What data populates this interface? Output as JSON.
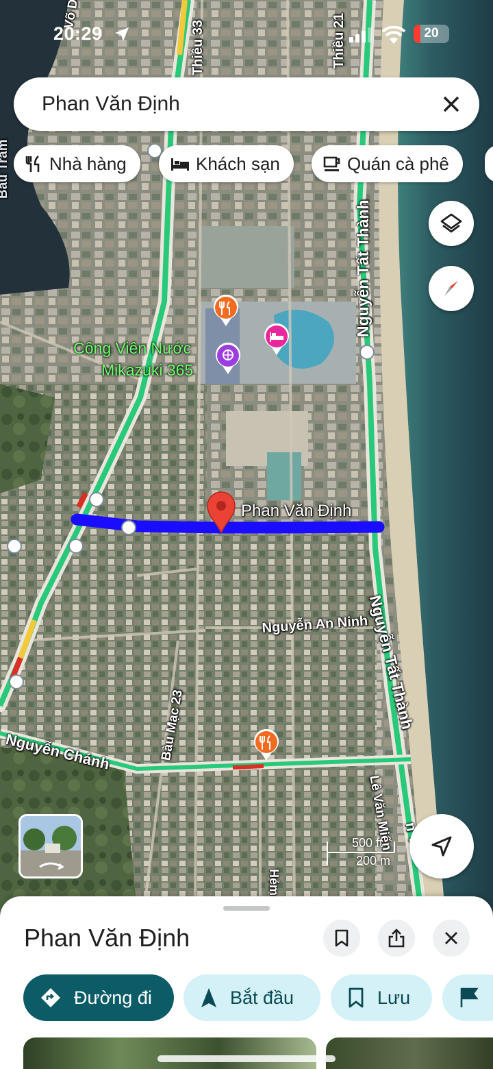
{
  "status_bar": {
    "time": "20:29",
    "battery": "20",
    "battery_fraction": 0.2
  },
  "search": {
    "query": "Phan Văn Định"
  },
  "chips": [
    {
      "label": "Nhà hàng",
      "icon": "fork-knife-icon"
    },
    {
      "label": "Khách sạn",
      "icon": "bed-icon"
    },
    {
      "label": "Quán cà phê",
      "icon": "coffee-cup-icon"
    }
  ],
  "map": {
    "street_labels": {
      "vo_duy_du": "Võ Duy Dư",
      "pham_thieu_33": "Thiều 33",
      "pham_thieu_21": "Thiều 21",
      "bau_tram": "Bàu Tràm",
      "nguyen_tat_thanh_1": "Nguyễn Tất Thành",
      "nguyen_tat_thanh_2": "Nguyễn Tất Thành",
      "nguyen_tat_thanh_3": "n Tấ",
      "nguyen_an_ninh": "Nguyễn An Ninh",
      "bau_mac_23": "Bàu Mạc 23",
      "nguyen_chanh": "Nguyễn Chánh",
      "le_van_miet": "Lê Văn Miến",
      "hem": "Hẻm"
    },
    "poi_label": [
      "Công Viên Nước",
      "Mikazuki 365"
    ],
    "pin_label": "Phan Văn Định",
    "scale": {
      "top": "500 ft",
      "bottom": "200 m"
    },
    "colors": {
      "route": "#1a0dff",
      "pin": "#ea4335",
      "road_green": "#29c97a",
      "road_yellow": "#f3c93a",
      "road_red": "#d93025"
    }
  },
  "sheet": {
    "title": "Phan Văn Định",
    "actions": [
      {
        "label": "Đường đi",
        "icon": "directions-icon"
      },
      {
        "label": "Bắt đầu",
        "icon": "navigation-arrow-icon"
      },
      {
        "label": "Lưu",
        "icon": "bookmark-icon"
      }
    ]
  }
}
